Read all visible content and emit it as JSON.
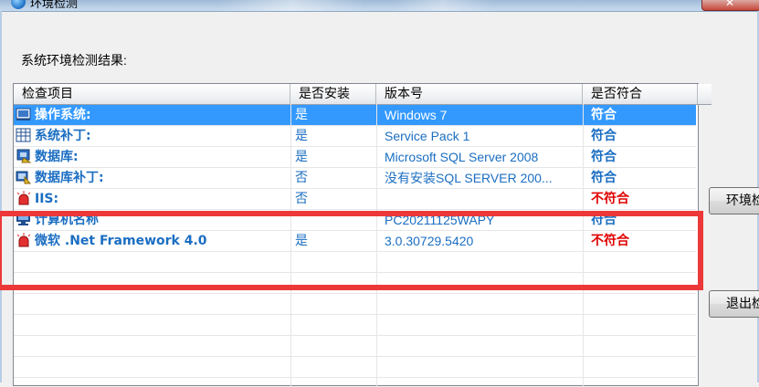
{
  "window": {
    "title": "环境检测",
    "close_glyph": "✕"
  },
  "section_label": "系统环境检测结果:",
  "table": {
    "columns": [
      "检查项目",
      "是否安装",
      "版本号",
      "是否符合"
    ],
    "rows": [
      {
        "icon": "computer-system-icon",
        "name": "操作系统:",
        "installed": "是",
        "version": "Windows 7",
        "status": "符合",
        "status_ok": true,
        "selected": true
      },
      {
        "icon": "patch-grid-icon",
        "name": "系统补丁:",
        "installed": "是",
        "version": "Service Pack 1",
        "status": "符合",
        "status_ok": true,
        "selected": false
      },
      {
        "icon": "database-icon",
        "name": "数据库:",
        "installed": "是",
        "version": "Microsoft SQL Server 2008",
        "status": "符合",
        "status_ok": true,
        "selected": false
      },
      {
        "icon": "database-patch-icon",
        "name": "数据库补丁:",
        "installed": "否",
        "version": "没有安装SQL SERVER 200...",
        "status": "符合",
        "status_ok": true,
        "selected": false
      },
      {
        "icon": "alarm-icon",
        "name": "IIS:",
        "installed": "否",
        "version": "",
        "status": "不符合",
        "status_ok": false,
        "selected": false
      },
      {
        "icon": "monitor-icon",
        "name": "计算机名称",
        "installed": "",
        "version": "PC20211125WAPY",
        "status": "符合",
        "status_ok": true,
        "selected": false
      },
      {
        "icon": "alarm-icon",
        "name": "微软 .Net Framework 4.0",
        "installed": "是",
        "version": "3.0.30729.5420",
        "status": "不符合",
        "status_ok": false,
        "selected": false
      }
    ]
  },
  "buttons": {
    "check": "环境检测",
    "exit": "退出检测"
  },
  "colors": {
    "selected_row": "#3399ff",
    "ok_text": "#1b6ec2",
    "fail_text": "#e00000",
    "highlight_box": "#ec3838"
  }
}
